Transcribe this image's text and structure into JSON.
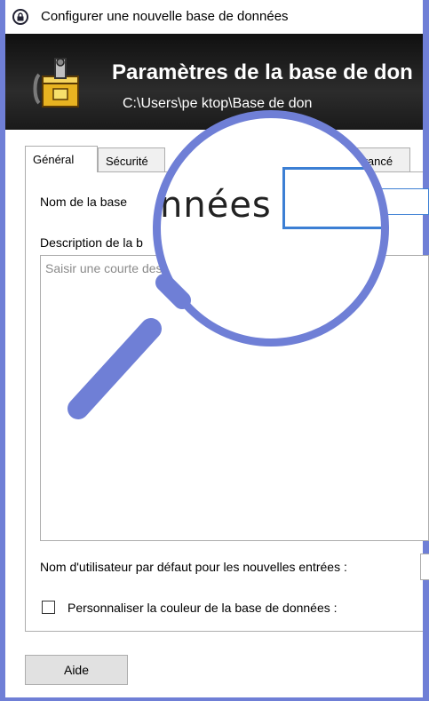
{
  "window": {
    "title": "Configurer une nouvelle base de données"
  },
  "header": {
    "title": "Paramètres de la base de don",
    "path": "C:\\Users\\pe         ktop\\Base de don"
  },
  "tabs": [
    {
      "label": "Général"
    },
    {
      "label": "Sécurité"
    },
    {
      "label": "Avancé"
    }
  ],
  "general": {
    "db_name_label": "Nom de la base",
    "db_name_value": "",
    "description_label": "Description de la b",
    "description_placeholder": "Saisir une courte des                         données ou lai",
    "default_user_label": "Nom d'utilisateur par défaut pour les nouvelles entrées :",
    "default_user_value": "",
    "customize_color_label": "Personnaliser la couleur de la base de données :",
    "customize_color_checked": false
  },
  "buttons": {
    "help": "Aide"
  },
  "magnifier": {
    "zoom_text": "nnées :"
  },
  "colors": {
    "accent_border": "#6f7fd6",
    "focus_blue": "#3c7fd4"
  },
  "icons": [
    "lock-icon",
    "database-icon",
    "magnifier-icon"
  ]
}
